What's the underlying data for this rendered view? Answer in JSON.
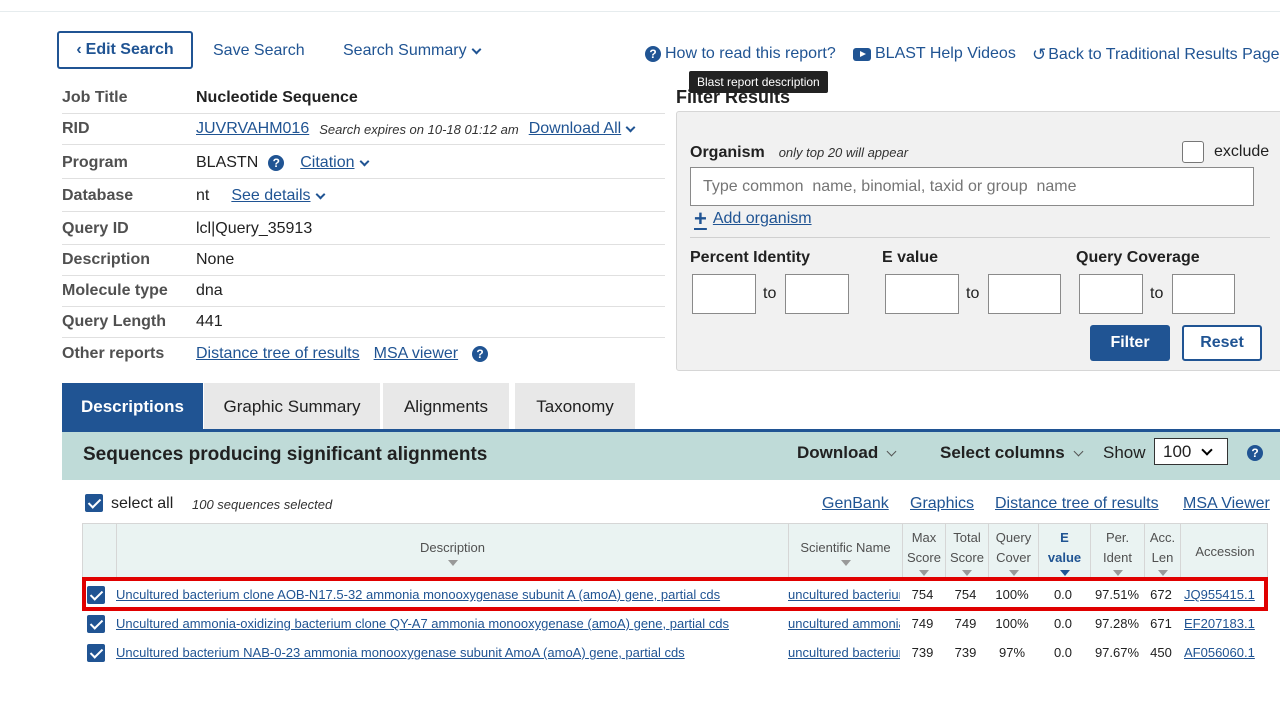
{
  "top_actions": {
    "edit_search": "Edit Search",
    "save_search": "Save Search",
    "search_summary": "Search Summary",
    "how_to_read": "How to read this report?",
    "blast_help": "BLAST Help Videos",
    "back_traditional": "Back to Traditional Results Page",
    "tooltip": "Blast report description"
  },
  "job_info": {
    "rows": [
      {
        "label": "Job Title",
        "value": "Nucleotide Sequence"
      },
      {
        "label": "RID",
        "value": "JUVRVAHM016",
        "note": "Search expires on 10-18 01:12 am",
        "link": "Download All"
      },
      {
        "label": "Program",
        "value": "BLASTN",
        "link": "Citation"
      },
      {
        "label": "Database",
        "value": "nt",
        "link": "See details"
      },
      {
        "label": "Query ID",
        "value": "lcl|Query_35913"
      },
      {
        "label": "Description",
        "value": "None"
      },
      {
        "label": "Molecule type",
        "value": "dna"
      },
      {
        "label": "Query Length",
        "value": "441"
      },
      {
        "label": "Other reports",
        "link1": "Distance tree of results",
        "link2": "MSA viewer"
      }
    ]
  },
  "filter": {
    "title": "Filter Results",
    "organism_label": "Organism",
    "organism_note": "only top 20 will appear",
    "exclude_label": "exclude",
    "organism_placeholder": "Type common  name, binomial, taxid or group  name",
    "add_organism": "Add organism",
    "percent_identity": "Percent Identity",
    "e_value": "E value",
    "query_coverage": "Query Coverage",
    "to": "to",
    "filter_btn": "Filter",
    "reset_btn": "Reset"
  },
  "tabs": [
    "Descriptions",
    "Graphic Summary",
    "Alignments",
    "Taxonomy"
  ],
  "results": {
    "title": "Sequences producing significant alignments",
    "download": "Download",
    "select_columns": "Select columns",
    "show": "Show",
    "show_value": "100",
    "select_all": "select all",
    "selected_count": "100 sequences selected",
    "links": [
      "GenBank",
      "Graphics",
      "Distance tree of results",
      "MSA Viewer"
    ],
    "columns": {
      "description": "Description",
      "scientific_name": "Scientific Name",
      "max_score": [
        "Max",
        "Score"
      ],
      "total_score": [
        "Total",
        "Score"
      ],
      "query_cover": [
        "Query",
        "Cover"
      ],
      "e_value": [
        "E",
        "value"
      ],
      "per_ident": [
        "Per.",
        "Ident"
      ],
      "acc_len": [
        "Acc.",
        "Len"
      ],
      "accession": "Accession"
    },
    "rows": [
      {
        "description": "Uncultured bacterium clone AOB-N17.5-32 ammonia monooxygenase subunit A (amoA) gene, partial cds",
        "scientific_name": "uncultured bacterium",
        "max_score": "754",
        "total_score": "754",
        "query_cover": "100%",
        "e_value": "0.0",
        "per_ident": "97.51%",
        "acc_len": "672",
        "accession": "JQ955415.1"
      },
      {
        "description": "Uncultured ammonia-oxidizing bacterium clone QY-A7 ammonia monooxygenase (amoA) gene, partial cds",
        "scientific_name": "uncultured ammonia-oxidizing bacterium",
        "max_score": "749",
        "total_score": "749",
        "query_cover": "100%",
        "e_value": "0.0",
        "per_ident": "97.28%",
        "acc_len": "671",
        "accession": "EF207183.1"
      },
      {
        "description": "Uncultured bacterium NAB-0-23 ammonia monooxygenase subunit AmoA (amoA) gene, partial cds",
        "scientific_name": "uncultured bacterium",
        "max_score": "739",
        "total_score": "739",
        "query_cover": "97%",
        "e_value": "0.0",
        "per_ident": "97.67%",
        "acc_len": "450",
        "accession": "AF056060.1"
      }
    ]
  },
  "colors": {
    "primary": "#205493",
    "highlight": "#e00000",
    "header_bg": "#bfdbd8"
  }
}
